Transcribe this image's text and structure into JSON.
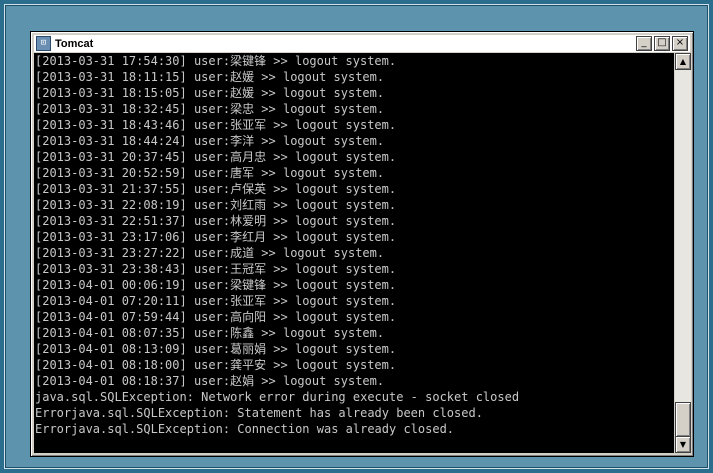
{
  "window": {
    "title": "Tomcat",
    "minimize_glyph": "_",
    "maximize_glyph": "□",
    "close_glyph": "×"
  },
  "scrollbar": {
    "up_glyph": "▲",
    "down_glyph": "▼"
  },
  "console_lines": [
    "[2013-03-31 17:54:30] user:梁键锋 >> logout system.",
    "[2013-03-31 18:11:15] user:赵媛 >> logout system.",
    "[2013-03-31 18:15:05] user:赵媛 >> logout system.",
    "[2013-03-31 18:32:45] user:梁忠 >> logout system.",
    "[2013-03-31 18:43:46] user:张亚军 >> logout system.",
    "[2013-03-31 18:44:24] user:李洋 >> logout system.",
    "[2013-03-31 20:37:45] user:高月忠 >> logout system.",
    "[2013-03-31 20:52:59] user:唐军 >> logout system.",
    "[2013-03-31 21:37:55] user:卢保英 >> logout system.",
    "[2013-03-31 22:08:19] user:刘红雨 >> logout system.",
    "[2013-03-31 22:51:37] user:林爱明 >> logout system.",
    "[2013-03-31 23:17:06] user:李红月 >> logout system.",
    "[2013-03-31 23:27:22] user:成道 >> logout system.",
    "[2013-03-31 23:38:43] user:王冠军 >> logout system.",
    "[2013-04-01 00:06:19] user:梁键锋 >> logout system.",
    "[2013-04-01 07:20:11] user:张亚军 >> logout system.",
    "[2013-04-01 07:59:44] user:高向阳 >> logout system.",
    "[2013-04-01 08:07:35] user:陈鑫 >> logout system.",
    "[2013-04-01 08:13:09] user:葛丽娟 >> logout system.",
    "[2013-04-01 08:18:00] user:龚平安 >> logout system.",
    "[2013-04-01 08:18:37] user:赵娟 >> logout system.",
    "java.sql.SQLException: Network error during execute - socket closed",
    "Errorjava.sql.SQLException: Statement has already been closed.",
    "Errorjava.sql.SQLException: Connection was already closed."
  ]
}
